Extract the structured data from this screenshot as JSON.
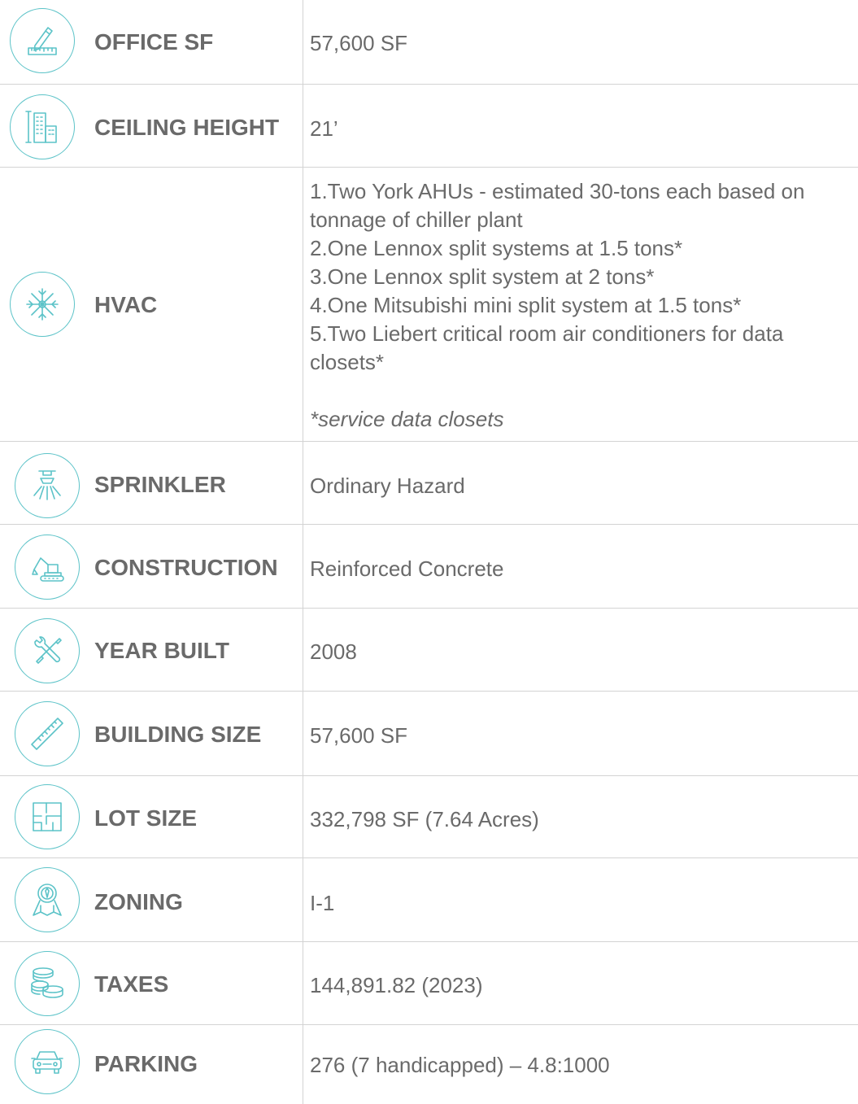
{
  "specs": [
    {
      "icon": "pencil-ruler-icon",
      "label": "OFFICE SF",
      "value": "57,600 SF"
    },
    {
      "icon": "building-height-icon",
      "label": "CEILING HEIGHT",
      "value": "21’"
    },
    {
      "icon": "snowflake-icon",
      "label": "HVAC",
      "lines": [
        "1.Two York AHUs - estimated 30-tons each based on tonnage of chiller plant",
        "2.One Lennox split systems at 1.5 tons*",
        "3.One Lennox split system at 2 tons*",
        "4.One Mitsubishi mini split system at 1.5 tons*",
        "5.Two Liebert critical room air conditioners for data closets*"
      ],
      "note": "*service data closets"
    },
    {
      "icon": "sprinkler-icon",
      "label": "SPRINKLER",
      "value": "Ordinary Hazard"
    },
    {
      "icon": "excavator-icon",
      "label": "CONSTRUCTION",
      "value": "Reinforced Concrete"
    },
    {
      "icon": "wrench-screwdriver-icon",
      "label": "YEAR BUILT",
      "value": "2008"
    },
    {
      "icon": "ruler-icon",
      "label": "BUILDING SIZE",
      "value": "57,600 SF"
    },
    {
      "icon": "floor-plan-icon",
      "label": "LOT SIZE",
      "value": "332,798 SF (7.64 Acres)"
    },
    {
      "icon": "map-pin-icon",
      "label": "ZONING",
      "value": "I-1"
    },
    {
      "icon": "coins-icon",
      "label": "TAXES",
      "value": "144,891.82 (2023)"
    },
    {
      "icon": "car-icon",
      "label": "PARKING",
      "value": "276 (7 handicapped) – 4.8:1000"
    }
  ],
  "colors": {
    "accent": "#5cc3c8",
    "text": "#6a6a6a",
    "rule": "#d3d3d3"
  }
}
